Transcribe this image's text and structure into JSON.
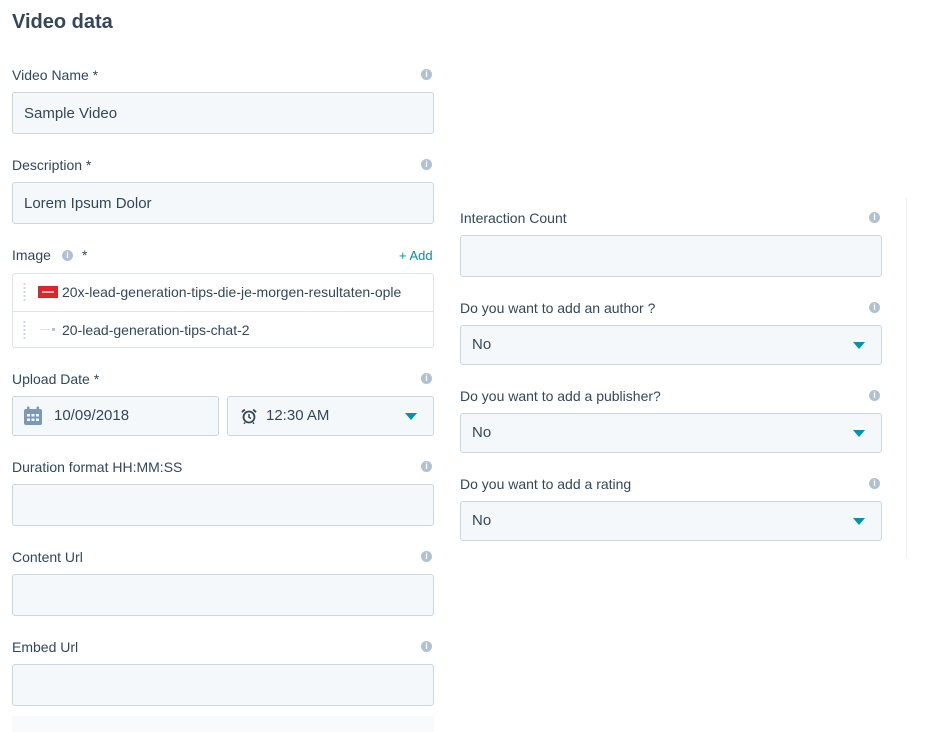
{
  "section_title": "Video data",
  "fields": {
    "video_name": {
      "label": "Video Name *",
      "value": "Sample Video"
    },
    "description": {
      "label": "Description *",
      "value": "Lorem Ipsum Dolor"
    },
    "image": {
      "label": "Image",
      "required_marker": "*",
      "add_label": "+ Add",
      "items": [
        {
          "name": "20x-lead-generation-tips-die-je-morgen-resultaten-ople"
        },
        {
          "name": "20-lead-generation-tips-chat-2"
        }
      ]
    },
    "upload_date": {
      "label": "Upload Date *",
      "date": "10/09/2018",
      "time": "12:30 AM"
    },
    "duration": {
      "label": "Duration format HH:MM:SS",
      "value": ""
    },
    "content_url": {
      "label": "Content Url",
      "value": ""
    },
    "embed_url": {
      "label": "Embed Url",
      "value": ""
    },
    "interaction_count": {
      "label": "Interaction Count",
      "value": ""
    },
    "add_author": {
      "label": "Do you want to add an author ?",
      "selected": "No"
    },
    "add_publisher": {
      "label": "Do you want to add a publisher?",
      "selected": "No"
    },
    "add_rating": {
      "label": "Do you want to add a rating",
      "selected": "No"
    }
  },
  "colors": {
    "accent": "#0091ae",
    "field_bg": "#f5f8fa",
    "border": "#cbd6e2",
    "text": "#33475b"
  },
  "icons": {
    "info": "info-icon",
    "calendar": "calendar-icon",
    "clock": "alarm-clock-icon",
    "dropdown": "caret-down-icon",
    "drag": "drag-handle-icon"
  }
}
